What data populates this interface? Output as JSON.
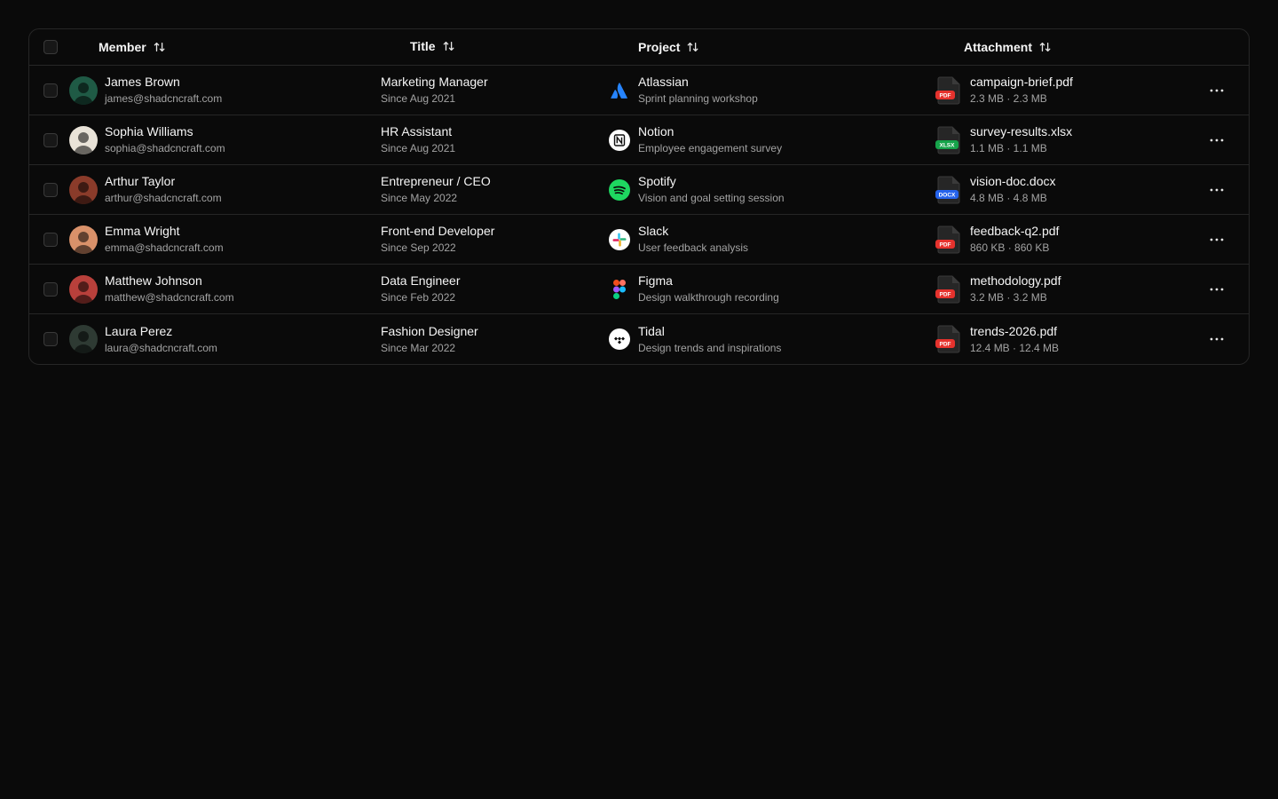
{
  "table": {
    "headers": {
      "member": "Member",
      "title": "Title",
      "project": "Project",
      "attachment": "Attachment"
    },
    "rows": [
      {
        "name": "James Brown",
        "email": "james@shadcncraft.com",
        "avatar_color": "#1f5a45",
        "title": "Marketing Manager",
        "since": "Since Aug 2021",
        "project": "Atlassian",
        "project_icon": "atlassian-logo",
        "project_desc": "Sprint planning workshop",
        "file": "campaign-brief.pdf",
        "file_type": "PDF",
        "file_color": "#e5322d",
        "file_size": "2.3 MB · 2.3 MB"
      },
      {
        "name": "Sophia Williams",
        "email": "sophia@shadcncraft.com",
        "avatar_color": "#e9e3d8",
        "title": "HR Assistant",
        "since": "Since Aug 2021",
        "project": "Notion",
        "project_icon": "notion-logo",
        "project_desc": "Employee engagement survey",
        "file": "survey-results.xlsx",
        "file_type": "XLSX",
        "file_color": "#16a34a",
        "file_size": "1.1 MB · 1.1 MB"
      },
      {
        "name": "Arthur Taylor",
        "email": "arthur@shadcncraft.com",
        "avatar_color": "#8a3b2a",
        "title": "Entrepreneur / CEO",
        "since": "Since May 2022",
        "project": "Spotify",
        "project_icon": "spotify-logo",
        "project_desc": "Vision and goal setting session",
        "file": "vision-doc.docx",
        "file_type": "DOCX",
        "file_color": "#2563eb",
        "file_size": "4.8 MB · 4.8 MB"
      },
      {
        "name": "Emma Wright",
        "email": "emma@shadcncraft.com",
        "avatar_color": "#d9916a",
        "title": "Front-end Developer",
        "since": "Since Sep 2022",
        "project": "Slack",
        "project_icon": "slack-logo",
        "project_desc": "User feedback analysis",
        "file": "feedback-q2.pdf",
        "file_type": "PDF",
        "file_color": "#e5322d",
        "file_size": "860 KB · 860 KB"
      },
      {
        "name": "Matthew Johnson",
        "email": "matthew@shadcncraft.com",
        "avatar_color": "#b8403b",
        "title": "Data Engineer",
        "since": "Since Feb 2022",
        "project": "Figma",
        "project_icon": "figma-logo",
        "project_desc": "Design walkthrough recording",
        "file": "methodology.pdf",
        "file_type": "PDF",
        "file_color": "#e5322d",
        "file_size": "3.2 MB · 3.2 MB"
      },
      {
        "name": "Laura Perez",
        "email": "laura@shadcncraft.com",
        "avatar_color": "#2e3a33",
        "title": "Fashion Designer",
        "since": "Since Mar 2022",
        "project": "Tidal",
        "project_icon": "tidal-logo",
        "project_desc": "Design trends and inspirations",
        "file": "trends-2026.pdf",
        "file_type": "PDF",
        "file_color": "#e5322d",
        "file_size": "12.4 MB · 12.4 MB"
      }
    ]
  }
}
